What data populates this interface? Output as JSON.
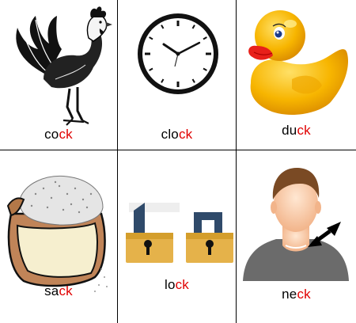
{
  "colors": {
    "highlight": "#e00000",
    "text": "#000000",
    "grid": "#000000"
  },
  "cards": [
    {
      "id": "cock",
      "image": "rooster",
      "prefix": "co",
      "suffix": "ck"
    },
    {
      "id": "clock",
      "image": "wall-clock",
      "prefix": "clo",
      "suffix": "ck"
    },
    {
      "id": "duck",
      "image": "rubber-duck",
      "prefix": "du",
      "suffix": "ck"
    },
    {
      "id": "sack",
      "image": "grain-sack",
      "prefix": "sa",
      "suffix": "ck"
    },
    {
      "id": "lock",
      "image": "padlocks",
      "prefix": "lo",
      "suffix": "ck"
    },
    {
      "id": "neck",
      "image": "person-neck",
      "prefix": "ne",
      "suffix": "ck"
    }
  ]
}
